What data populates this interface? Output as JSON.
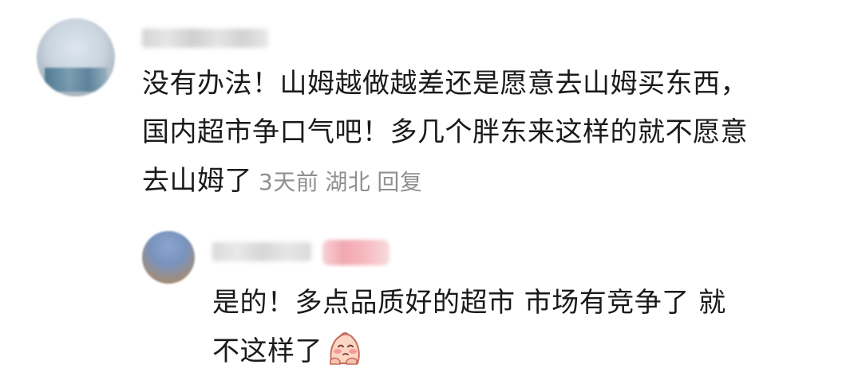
{
  "main_comment": {
    "text": "没有办法！山姆越做越差还是愿意去山姆买东西，国内超市争口气吧！多几个胖东来这样的就不愿意去山姆了",
    "time": "3天前",
    "location": "湖北",
    "reply_label": "回复"
  },
  "reply": {
    "text": "是的！多点品质好的超市 市场有竞争了 就不这样了",
    "emoji_icon": "blushing-face-icon"
  }
}
